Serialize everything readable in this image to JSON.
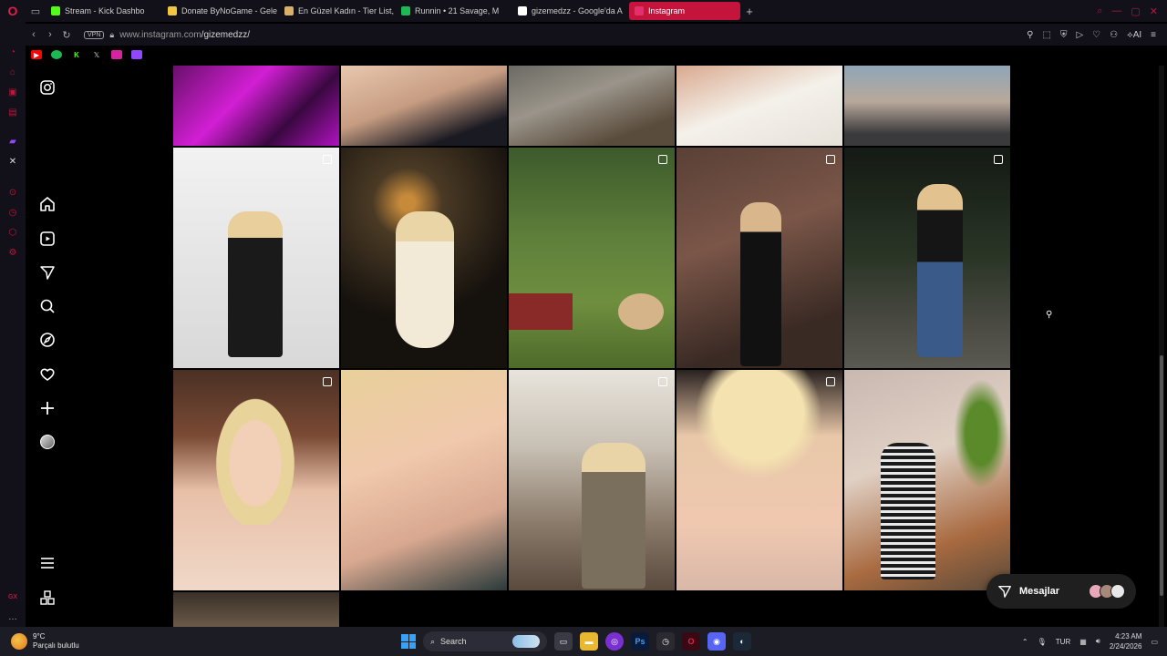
{
  "browser": {
    "tabs": [
      {
        "label": "Stream - Kick Dashbo",
        "favicon": "kick-icon",
        "color": "#53fc18"
      },
      {
        "label": "Donate ByNoGame - Gele",
        "favicon": "bynogame-icon",
        "color": "#f4c542"
      },
      {
        "label": "En Güzel Kadın - Tier List,",
        "favicon": "tierlist-icon",
        "color": "#d8b06a"
      },
      {
        "label": "Runnin • 21 Savage, M",
        "favicon": "spotify-icon",
        "color": "#1db954"
      },
      {
        "label": "gizemedzz - Google'da A",
        "favicon": "google-icon",
        "color": "#ffffff"
      },
      {
        "label": "Instagram",
        "favicon": "instagram-icon",
        "color": "#e1306c"
      }
    ],
    "active_tab_index": 5,
    "address": {
      "vpn_label": "VPN",
      "url_host": "www.instagram.com",
      "url_path": "/gizemedzz/"
    },
    "addr_ai_label": "AI"
  },
  "instagram": {
    "nav": [
      {
        "name": "instagram-logo-icon"
      },
      {
        "name": "home-icon"
      },
      {
        "name": "reels-icon"
      },
      {
        "name": "direct-icon"
      },
      {
        "name": "search-icon"
      },
      {
        "name": "explore-icon"
      },
      {
        "name": "notifications-heart-icon"
      },
      {
        "name": "create-plus-icon"
      },
      {
        "name": "profile-avatar"
      },
      {
        "name": "more-menu-icon"
      },
      {
        "name": "also-from-meta-icon"
      }
    ],
    "messages_label": "Mesajlar"
  },
  "taskbar": {
    "weather_temp": "9°C",
    "weather_desc": "Parçalı bulutlu",
    "search_label": "Search",
    "language": "TUR",
    "time": "4:23 AM",
    "date": "2/24/2026"
  },
  "colors": {
    "accent": "#c4143c",
    "background": "#000000"
  }
}
